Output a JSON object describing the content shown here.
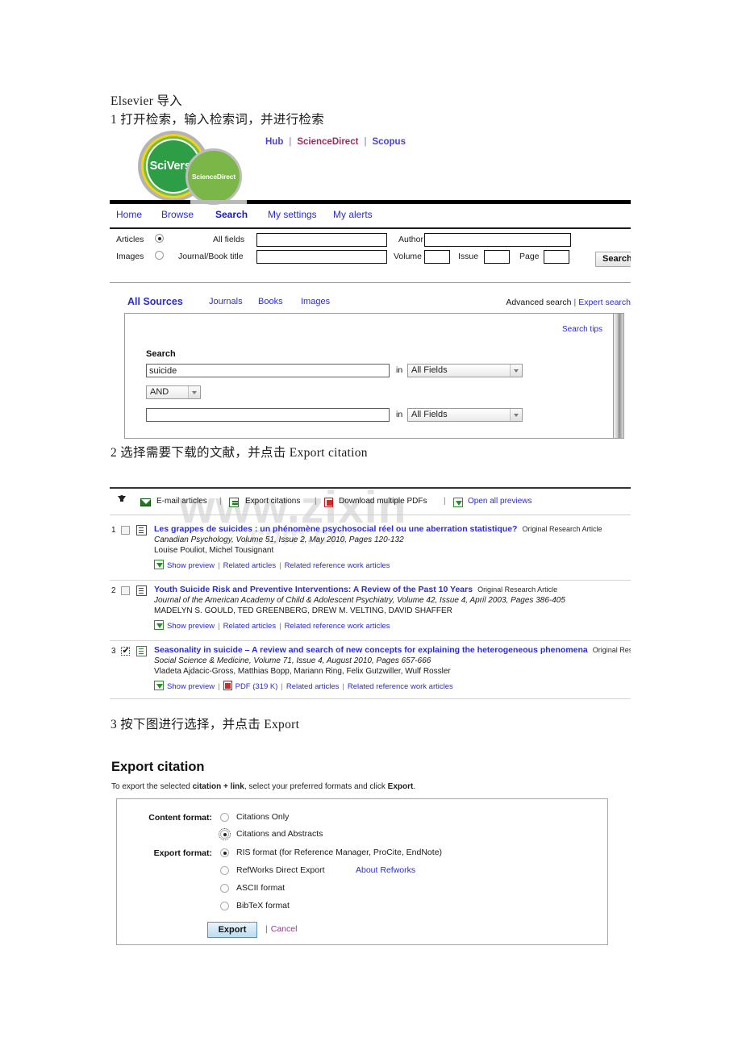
{
  "doc": {
    "heading": "Elsevier 导入",
    "step1": "1 打开检索，输入检索词，并进行检索",
    "step2": "2 选择需要下载的文献，并点击 Export citation",
    "step3": "3 按下图进行选择，并点击 Export"
  },
  "watermark": {
    "line1": "www.zixin",
    "line2": ".com.cn"
  },
  "sciverse": {
    "logo_main": "SciVerse",
    "logo_sub": "ScienceDirect",
    "top_links": [
      {
        "label": "Hub",
        "color": "#4b3fd6"
      },
      {
        "label": "ScienceDirect",
        "color": "#9e2b5e"
      },
      {
        "label": "Scopus",
        "color": "#4b3fd6"
      }
    ],
    "nav": [
      {
        "label": "Home",
        "active": false
      },
      {
        "label": "Browse",
        "active": false
      },
      {
        "label": "Search",
        "active": true
      },
      {
        "label": "My settings",
        "active": false
      },
      {
        "label": "My alerts",
        "active": false
      }
    ],
    "quick_search": {
      "articles_label": "Articles",
      "articles_selected": true,
      "images_label": "Images",
      "images_selected": false,
      "all_fields_label": "All fields",
      "all_fields_value": "",
      "journal_book_label": "Journal/Book title",
      "journal_book_value": "",
      "author_label": "Author",
      "author_value": "",
      "volume_label": "Volume",
      "volume_value": "",
      "issue_label": "Issue",
      "issue_value": "",
      "page_label": "Page",
      "page_value": "",
      "search_button": "Search Sci"
    },
    "sources_tabs": [
      {
        "label": "All Sources",
        "active": true
      },
      {
        "label": "Journals",
        "active": false
      },
      {
        "label": "Books",
        "active": false
      },
      {
        "label": "Images",
        "active": false
      }
    ],
    "advanced_search": "Advanced search",
    "divider": "|",
    "expert_search": "Expert search",
    "search_tips": "Search tips",
    "panel": {
      "label": "Search",
      "term1": "suicide",
      "term2": "",
      "in_label": "in",
      "field1": "All Fields",
      "field2": "All Fields",
      "operator": "AND"
    }
  },
  "results": {
    "toolbar": [
      {
        "icon": "download-arrow-icon",
        "label": "",
        "link": false
      },
      {
        "icon": "envelope-icon",
        "label": "E-mail articles",
        "link": false
      },
      {
        "icon": "export-icon",
        "label": "Export citations",
        "link": false
      },
      {
        "icon": "pdf-icon",
        "label": "Download multiple PDFs",
        "link": false
      },
      {
        "icon": "preview-icon",
        "label": "Open all previews",
        "link": true
      }
    ],
    "separator": "|",
    "items": [
      {
        "num": "1",
        "checked": false,
        "title": "Les grappes de  suicides : un phénomène psychosocial réel ou une aberration statistique?",
        "type": "Original Research Article",
        "source": "Canadian Psychology, Volume 51, Issue 2, May 2010, Pages 120-132",
        "authors": "Louise Pouliot, Michel Tousignant",
        "actions": [
          {
            "label": "Show preview",
            "icon": "preview-icon"
          },
          {
            "label": "Related articles",
            "icon": ""
          },
          {
            "label": "Related reference work articles",
            "icon": ""
          }
        ]
      },
      {
        "num": "2",
        "checked": false,
        "title": "Youth  Suicide  Risk and Preventive Interventions: A Review of the Past 10 Years",
        "type": "Original Research Article",
        "source": "Journal of the American Academy of Child & Adolescent Psychiatry, Volume 42, Issue 4, April 2003, Pages 386-405",
        "authors": "MADELYN S. GOULD, TED GREENBERG, DREW M. VELTING, DAVID SHAFFER",
        "actions": [
          {
            "label": "Show preview",
            "icon": "preview-icon"
          },
          {
            "label": "Related articles",
            "icon": ""
          },
          {
            "label": "Related reference work articles",
            "icon": ""
          }
        ]
      },
      {
        "num": "3",
        "checked": true,
        "title": "Seasonality in  suicide  – A review and search of new concepts for explaining the heterogeneous phenomena",
        "type": "Original Rese",
        "source": "Social Science & Medicine, Volume 71, Issue 4, August 2010, Pages 657-666",
        "authors": "Vladeta Ajdacic-Gross, Matthias Bopp, Mariann Ring, Felix Gutzwiller, Wulf Rossler",
        "actions": [
          {
            "label": "Show preview",
            "icon": "preview-icon"
          },
          {
            "label": "PDF (319 K)",
            "icon": "pdf-icon"
          },
          {
            "label": "Related articles",
            "icon": ""
          },
          {
            "label": "Related reference work articles",
            "icon": ""
          }
        ]
      }
    ]
  },
  "export_citation": {
    "title": "Export citation",
    "intro_a": "To export the selected ",
    "intro_b": "citation + link",
    "intro_c": ", select your preferred formats and click ",
    "intro_d": "Export",
    "intro_e": ".",
    "content_format_label": "Content format:",
    "content_options": [
      {
        "label": "Citations Only",
        "selected": false
      },
      {
        "label": "Citations and Abstracts",
        "selected": true
      }
    ],
    "export_format_label": "Export format:",
    "export_options": [
      {
        "label": "RIS format (for Reference Manager, ProCite, EndNote)",
        "selected": true
      },
      {
        "label": "RefWorks Direct Export",
        "selected": false
      },
      {
        "label": "ASCII format",
        "selected": false
      },
      {
        "label": "BibTeX format",
        "selected": false
      }
    ],
    "about_refworks": "About Refworks",
    "export_button": "Export",
    "cancel_divider": "|",
    "cancel_label": "Cancel"
  }
}
